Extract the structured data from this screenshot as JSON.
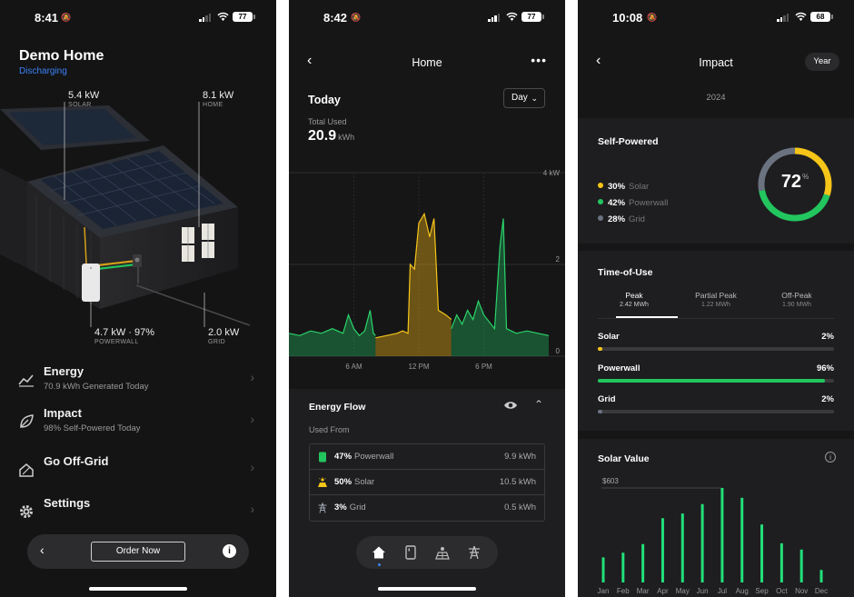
{
  "status1": {
    "time": "8:41",
    "battery": "77"
  },
  "status2": {
    "time": "8:42",
    "battery": "77"
  },
  "status3": {
    "time": "10:08",
    "battery": "68"
  },
  "home": {
    "title": "Demo Home",
    "state": "Discharging",
    "solar": {
      "value": "5.4 kW",
      "label": "SOLAR"
    },
    "home_load": {
      "value": "8.1 kW",
      "label": "HOME"
    },
    "powerwall": {
      "value": "4.7 kW · 97%",
      "label": "POWERWALL"
    },
    "grid": {
      "value": "2.0 kW",
      "label": "GRID"
    },
    "menu": [
      {
        "title": "Energy",
        "sub": "70.9 kWh Generated Today",
        "icon": "trend-icon"
      },
      {
        "title": "Impact",
        "sub": "98% Self-Powered Today",
        "icon": "leaf-icon"
      },
      {
        "title": "Go Off-Grid",
        "sub": "",
        "icon": "house-icon"
      },
      {
        "title": "Settings",
        "sub": "",
        "icon": "gear-icon"
      }
    ],
    "order_label": "Order Now"
  },
  "energy": {
    "nav_title": "Home",
    "period_title": "Today",
    "period_select": "Day",
    "total_label": "Total Used",
    "total_value": "20.9",
    "total_unit": "kWh",
    "flow_title": "Energy Flow",
    "used_from": "Used From",
    "sources": [
      {
        "pct": "47%",
        "name": "Powerwall",
        "value": "9.9 kWh",
        "color": "#22c55e"
      },
      {
        "pct": "50%",
        "name": "Solar",
        "value": "10.5 kWh",
        "color": "#f5c518"
      },
      {
        "pct": "3%",
        "name": "Grid",
        "value": "0.5 kWh",
        "color": "#9ca3af"
      }
    ]
  },
  "chart_data": {
    "type": "area",
    "title": "",
    "xlabel": "",
    "ylabel": "",
    "y_ticks": [
      "4 kW",
      "2",
      "0"
    ],
    "ylim": [
      0,
      4
    ],
    "x_ticks": [
      {
        "hour": 6,
        "label": "6 AM"
      },
      {
        "hour": 12,
        "label": "12 PM"
      },
      {
        "hour": 18,
        "label": "6 PM"
      }
    ],
    "xlim_hours": [
      0,
      24
    ],
    "series": [
      {
        "name": "Powerwall",
        "color": "#1f9d55",
        "points": [
          [
            0,
            0.5
          ],
          [
            1,
            0.45
          ],
          [
            2,
            0.55
          ],
          [
            3,
            0.5
          ],
          [
            4,
            0.6
          ],
          [
            5,
            0.5
          ],
          [
            5.5,
            0.9
          ],
          [
            6,
            0.6
          ],
          [
            6.5,
            0.45
          ],
          [
            7,
            0.55
          ],
          [
            7.5,
            1.0
          ],
          [
            7.8,
            0.5
          ],
          [
            8,
            0.45
          ]
        ]
      },
      {
        "name": "Solar",
        "color": "#d4a017",
        "points": [
          [
            8,
            0.4
          ],
          [
            9,
            0.45
          ],
          [
            10,
            0.5
          ],
          [
            10.5,
            0.55
          ],
          [
            11,
            0.5
          ],
          [
            11.2,
            2.0
          ],
          [
            11.6,
            1.9
          ],
          [
            12,
            2.9
          ],
          [
            12.5,
            3.1
          ],
          [
            13,
            2.6
          ],
          [
            13.4,
            3.0
          ],
          [
            13.8,
            1.0
          ],
          [
            14.5,
            0.9
          ],
          [
            15,
            0.8
          ]
        ]
      },
      {
        "name": "Powerwall",
        "color": "#1f9d55",
        "points": [
          [
            15,
            0.6
          ],
          [
            15.5,
            0.9
          ],
          [
            16,
            0.7
          ],
          [
            16.5,
            1.0
          ],
          [
            17,
            0.8
          ],
          [
            17.5,
            1.2
          ],
          [
            18,
            0.9
          ],
          [
            19,
            0.6
          ],
          [
            19.5,
            2.4
          ],
          [
            19.8,
            3.0
          ],
          [
            20.1,
            0.6
          ],
          [
            21,
            0.5
          ],
          [
            22,
            0.55
          ],
          [
            23,
            0.5
          ],
          [
            24,
            0.45
          ]
        ]
      }
    ]
  },
  "impact": {
    "nav_title": "Impact",
    "range_button": "Year",
    "year": "2024",
    "self_powered_title": "Self-Powered",
    "self_powered_value": "72",
    "pct_symbol": "%",
    "breakdown": [
      {
        "pct": "30%",
        "name": "Solar",
        "color": "#f5c518",
        "fraction": 0.3
      },
      {
        "pct": "42%",
        "name": "Powerwall",
        "color": "#22c55e",
        "fraction": 0.42
      },
      {
        "pct": "28%",
        "name": "Grid",
        "color": "#6b7280",
        "fraction": 0.28
      }
    ],
    "tou_title": "Time-of-Use",
    "tou_tabs": [
      {
        "label": "Peak",
        "value": "2.42 MWh"
      },
      {
        "label": "Partial Peak",
        "value": "1.22 MWh"
      },
      {
        "label": "Off-Peak",
        "value": "1.90 MWh"
      }
    ],
    "tou_bars": [
      {
        "name": "Solar",
        "pct": "2%",
        "fraction": 0.02,
        "color": "#f5c518"
      },
      {
        "name": "Powerwall",
        "pct": "96%",
        "fraction": 0.96,
        "color": "#22c55e"
      },
      {
        "name": "Grid",
        "pct": "2%",
        "fraction": 0.02,
        "color": "#6b7280"
      }
    ],
    "solar_value_title": "Solar Value",
    "solar_value_max_label": "$603",
    "solar_value_months": [
      "Jan",
      "Feb",
      "Mar",
      "Apr",
      "May",
      "Jun",
      "Jul",
      "Aug",
      "Sep",
      "Oct",
      "Nov",
      "Dec"
    ],
    "solar_value_values": [
      160,
      190,
      245,
      410,
      440,
      500,
      603,
      540,
      370,
      250,
      210,
      80
    ],
    "solar_value_max": 603,
    "bar_color": "#22e07a"
  }
}
